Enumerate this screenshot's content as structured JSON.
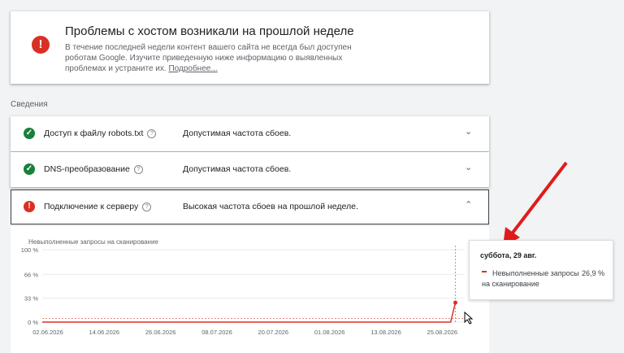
{
  "alert": {
    "icon": "error-icon",
    "title": "Проблемы с хостом возникали на прошлой неделе",
    "body": "В течение последней недели контент вашего сайта не всегда был доступен роботам Google. Изучите приведенную ниже информацию о выявленных проблемах и устраните их.",
    "link": "Подробнее..."
  },
  "section_label": "Сведения",
  "rows": [
    {
      "name": "Доступ к файлу robots.txt",
      "status": "Допустимая частота сбоев.",
      "state": "ok",
      "chevron": "⌄"
    },
    {
      "name": "DNS-преобразование",
      "status": "Допустимая частота сбоев.",
      "state": "ok",
      "chevron": "⌄"
    },
    {
      "name": "Подключение к серверу",
      "status": "Высокая частота сбоев на прошлой неделе.",
      "state": "error",
      "chevron": "⌃"
    }
  ],
  "chart_data": {
    "type": "line",
    "title": "Невыполненные запросы на сканирование",
    "yticks": [
      "100 %",
      "66 %",
      "33 %",
      "0 %"
    ],
    "ylim": [
      0,
      100
    ],
    "x_ticks": [
      "02.06.2026",
      "14.06.2026",
      "26.06.2026",
      "08.07.2026",
      "20.07.2026",
      "01.08.2026",
      "13.08.2026",
      "25.08.2026"
    ],
    "series": [
      {
        "name": "Невыполненные запросы на сканирование",
        "color": "#d93025",
        "x": [
          "02.06.2026",
          "25.08.2026",
          "28.08.2026",
          "29.08.2026"
        ],
        "y": [
          0,
          0,
          0,
          26.9
        ]
      }
    ],
    "threshold": 5,
    "grid": true
  },
  "tooltip": {
    "date": "суббота, 29 авг.",
    "series": "Невыполненные запросы на сканирование",
    "value": "26,9 %"
  }
}
